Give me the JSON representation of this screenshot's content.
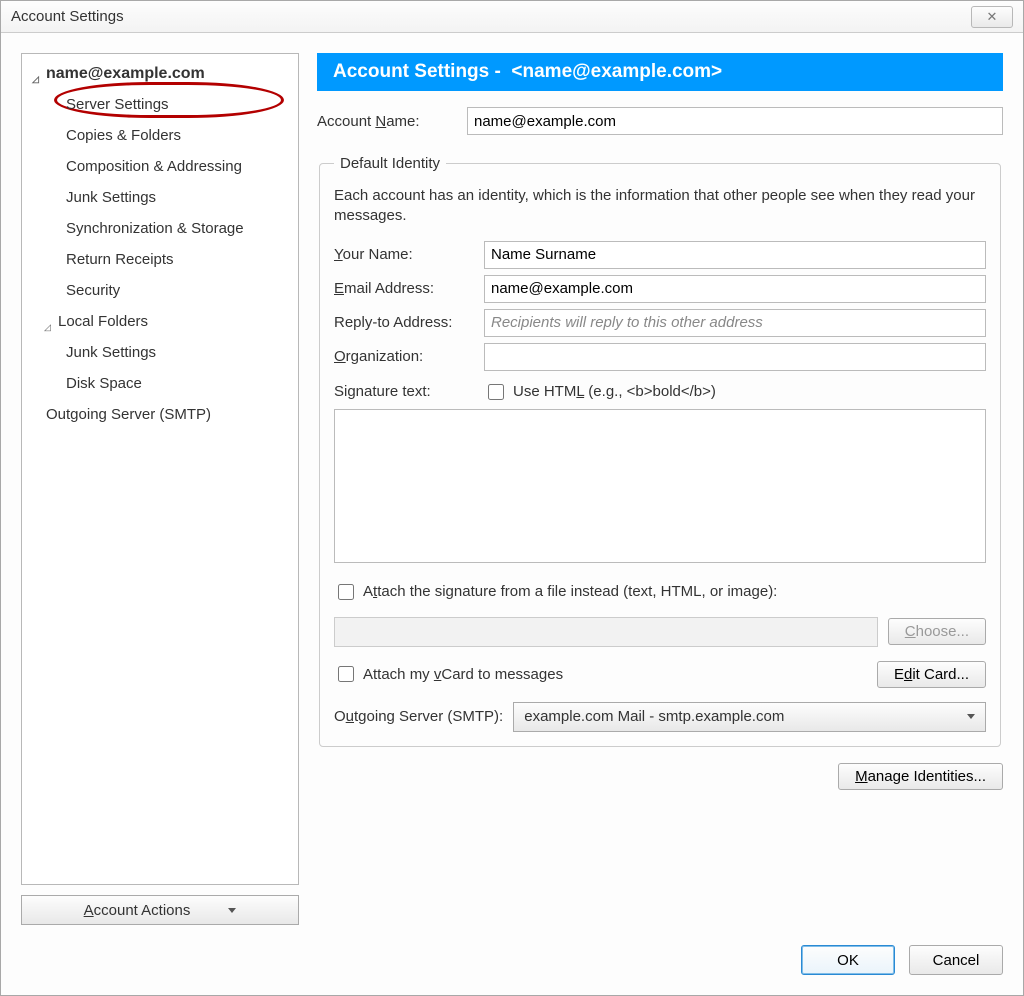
{
  "window": {
    "title": "Account Settings"
  },
  "sidebar": {
    "account": "name@example.com",
    "items": [
      "Server Settings",
      "Copies & Folders",
      "Composition & Addressing",
      "Junk Settings",
      "Synchronization & Storage",
      "Return Receipts",
      "Security"
    ],
    "local": {
      "label": "Local Folders",
      "items": [
        "Junk Settings",
        "Disk Space"
      ]
    },
    "smtp": "Outgoing Server (SMTP)",
    "actions_label": "Account Actions"
  },
  "banner": {
    "prefix": "Account Settings - ",
    "email": "<name@example.com>"
  },
  "acct_name": {
    "label": "Account Name:",
    "value": "name@example.com"
  },
  "identity": {
    "legend": "Default Identity",
    "help": "Each account has an identity, which is the information that other people see when they read your messages.",
    "your_name": {
      "label": "Your Name:",
      "value": "Name Surname"
    },
    "email": {
      "label": "Email Address:",
      "value": "name@example.com"
    },
    "reply": {
      "label": "Reply-to Address:",
      "placeholder": "Recipients will reply to this other address",
      "value": ""
    },
    "org": {
      "label": "Organization:",
      "value": ""
    },
    "sig_label": "Signature text:",
    "use_html": "Use HTML (e.g., <b>bold</b>)",
    "attach_file": "Attach the signature from a file instead (text, HTML, or image):",
    "choose": "Choose...",
    "attach_vcard": "Attach my vCard to messages",
    "edit_card": "Edit Card...",
    "smtp_label": "Outgoing Server (SMTP):",
    "smtp_value": "example.com Mail - smtp.example.com"
  },
  "manage": "Manage Identities...",
  "footer": {
    "ok": "OK",
    "cancel": "Cancel"
  }
}
